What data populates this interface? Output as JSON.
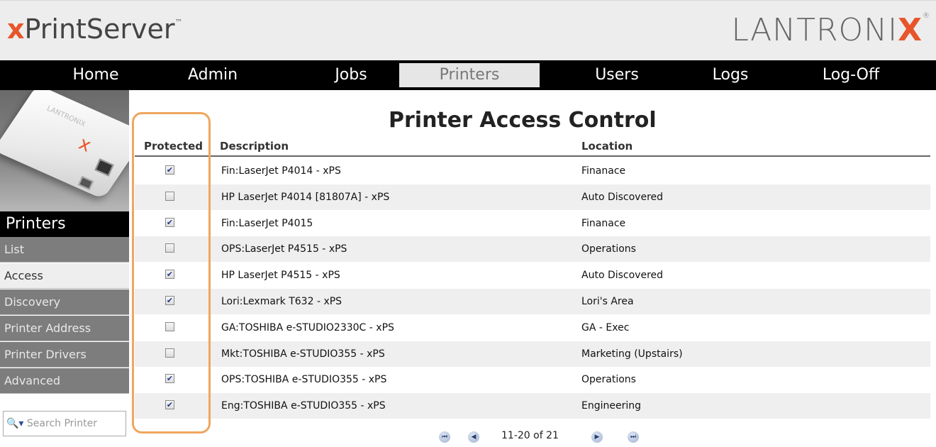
{
  "header": {
    "brand_x": "x",
    "brand_rest": "PrintServer",
    "brand_tm": "™",
    "vendor_main": "LANTRONI",
    "vendor_x": "X",
    "vendor_reg": "®"
  },
  "nav": {
    "items": [
      {
        "label": "Home"
      },
      {
        "label": "Admin"
      },
      {
        "label": "Jobs"
      },
      {
        "label": "Printers",
        "active": true
      },
      {
        "label": "Users"
      },
      {
        "label": "Logs"
      },
      {
        "label": "Log-Off"
      }
    ]
  },
  "sidebar": {
    "device_logo_text": "LANTRONIX",
    "device_x": "x",
    "title": "Printers",
    "items": [
      {
        "label": "List"
      },
      {
        "label": "Access",
        "active": true
      },
      {
        "label": "Discovery"
      },
      {
        "label": "Printer Address"
      },
      {
        "label": "Printer Drivers"
      },
      {
        "label": "Advanced"
      }
    ],
    "search_placeholder": "Search Printer"
  },
  "main": {
    "title": "Printer Access Control",
    "columns": {
      "protected": "Protected",
      "description": "Description",
      "location": "Location"
    },
    "rows": [
      {
        "protected": true,
        "description": "Fin:LaserJet P4014 - xPS",
        "location": "Finanace"
      },
      {
        "protected": false,
        "description": "HP LaserJet P4014 [81807A] - xPS",
        "location": "Auto Discovered"
      },
      {
        "protected": true,
        "description": "Fin:LaserJet P4015",
        "location": "Finanace"
      },
      {
        "protected": false,
        "description": "OPS:LaserJet P4515 - xPS",
        "location": "Operations"
      },
      {
        "protected": true,
        "description": "HP LaserJet P4515 - xPS",
        "location": "Auto Discovered"
      },
      {
        "protected": true,
        "description": "Lori:Lexmark T632 - xPS",
        "location": "Lori's Area"
      },
      {
        "protected": false,
        "description": "GA:TOSHIBA e-STUDIO2330C - xPS",
        "location": "GA - Exec"
      },
      {
        "protected": false,
        "description": "Mkt:TOSHIBA e-STUDIO355 - xPS",
        "location": "Marketing (Upstairs)"
      },
      {
        "protected": true,
        "description": "OPS:TOSHIBA e-STUDIO355 - xPS",
        "location": "Operations"
      },
      {
        "protected": true,
        "description": "Eng:TOSHIBA e-STUDIO355 - xPS",
        "location": "Engineering"
      }
    ],
    "pager": {
      "info": "11-20 of 21"
    }
  },
  "colors": {
    "accent": "#e8552a",
    "highlight": "#f0a560",
    "nav_bg": "#000000",
    "sidebar_item_bg": "#7d7d7d"
  }
}
